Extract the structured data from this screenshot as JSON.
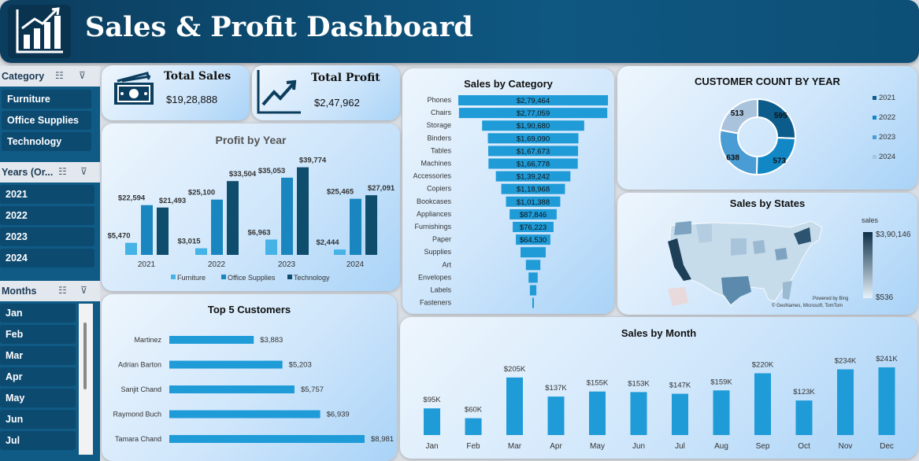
{
  "header": {
    "title": "Sales & Profit Dashboard",
    "logo_icon": "bar-chart-logo-icon"
  },
  "slicers": {
    "category": {
      "label": "Category",
      "items": [
        "Furniture",
        "Office Supplies",
        "Technology"
      ]
    },
    "years": {
      "label": "Years (Or...",
      "items": [
        "2021",
        "2022",
        "2023",
        "2024"
      ]
    },
    "months": {
      "label": "Months",
      "items": [
        "Jan",
        "Feb",
        "Mar",
        "Apr",
        "May",
        "Jun",
        "Jul"
      ]
    }
  },
  "kpis": {
    "total_sales": {
      "label": "Total Sales",
      "value": "$19,28,888",
      "icon": "money-icon"
    },
    "total_profit": {
      "label": "Total Profit",
      "value": "$2,47,962",
      "icon": "trend-up-icon"
    }
  },
  "colors": {
    "furniture": "#45b3e6",
    "office": "#1a86c0",
    "technology": "#0f4d6d",
    "bar": "#1f9bd8",
    "accent": "#0f5b86"
  },
  "chart_data": [
    {
      "id": "profit_by_year",
      "type": "bar",
      "title": "Profit by Year",
      "categories": [
        "2021",
        "2022",
        "2023",
        "2024"
      ],
      "series": [
        {
          "name": "Furniture",
          "values": [
            5470,
            3015,
            6963,
            2444
          ],
          "labels": [
            "$5,470",
            "$3,015",
            "$6,963",
            "$2,444"
          ]
        },
        {
          "name": "Office Supplies",
          "values": [
            22594,
            25100,
            35053,
            25465
          ],
          "labels": [
            "$22,594",
            "$25,100",
            "$35,053",
            "$25,465"
          ]
        },
        {
          "name": "Technology",
          "values": [
            21493,
            33504,
            39774,
            27091
          ],
          "labels": [
            "$21,493",
            "$33,504",
            "$39,774",
            "$27,091"
          ]
        }
      ],
      "legend": "bottom"
    },
    {
      "id": "sales_by_category",
      "type": "bar",
      "title": "Sales by Category",
      "orientation": "horizontal-funnel",
      "categories": [
        "Phones",
        "Chairs",
        "Storage",
        "Binders",
        "Tables",
        "Machines",
        "Accessories",
        "Copiers",
        "Bookcases",
        "Appliances",
        "Furnishings",
        "Paper",
        "Supplies",
        "Art",
        "Envelopes",
        "Labels",
        "Fasteners"
      ],
      "values": [
        279464,
        277059,
        190680,
        169090,
        167673,
        166778,
        139242,
        118968,
        101388,
        87846,
        76223,
        64530,
        47000,
        27000,
        17000,
        12000,
        3000
      ],
      "labels": [
        "$2,79,464",
        "$2,77,059",
        "$1,90,680",
        "$1,69,090",
        "$1,67,673",
        "$1,66,778",
        "$1,39,242",
        "$1,18,968",
        "$1,01,388",
        "$87,846",
        "$76,223",
        "$64,530",
        "",
        "",
        "",
        "",
        ""
      ]
    },
    {
      "id": "customer_count_by_year",
      "type": "pie",
      "title": "CUSTOMER COUNT BY YEAR",
      "categories": [
        "2021",
        "2022",
        "2023",
        "2024"
      ],
      "values": [
        595,
        573,
        638,
        513
      ],
      "labels": [
        "595",
        "573",
        "638",
        "513"
      ],
      "colors": [
        "#0b5c8a",
        "#1187c6",
        "#4a9dd4",
        "#aac3dd"
      ],
      "legend": "right"
    },
    {
      "id": "top_5_customers",
      "type": "bar",
      "title": "Top 5 Customers",
      "orientation": "horizontal",
      "categories": [
        "Martinez",
        "Adrian Barton",
        "Sanjit Chand",
        "Raymond Buch",
        "Tamara Chand"
      ],
      "values": [
        3883,
        5203,
        5757,
        6939,
        8981
      ],
      "labels": [
        "$3,883",
        "$5,203",
        "$5,757",
        "$6,939",
        "$8,981"
      ]
    },
    {
      "id": "sales_by_month",
      "type": "bar",
      "title": "Sales by Month",
      "categories": [
        "Jan",
        "Feb",
        "Mar",
        "Apr",
        "May",
        "Jun",
        "Jul",
        "Aug",
        "Sep",
        "Oct",
        "Nov",
        "Dec"
      ],
      "values": [
        95,
        60,
        205,
        137,
        155,
        153,
        147,
        159,
        220,
        123,
        234,
        241
      ],
      "labels": [
        "$95K",
        "$60K",
        "$205K",
        "$137K",
        "$155K",
        "$153K",
        "$147K",
        "$159K",
        "$220K",
        "$123K",
        "$234K",
        "$241K"
      ]
    }
  ],
  "map": {
    "title": "Sales by States",
    "legend_title": "sales",
    "legend_max": "$3,90,146",
    "legend_min": "$536",
    "attribution_powered": "Powered by Bing",
    "attribution_copy": "© GeoNames, Microsoft, TomTom"
  }
}
